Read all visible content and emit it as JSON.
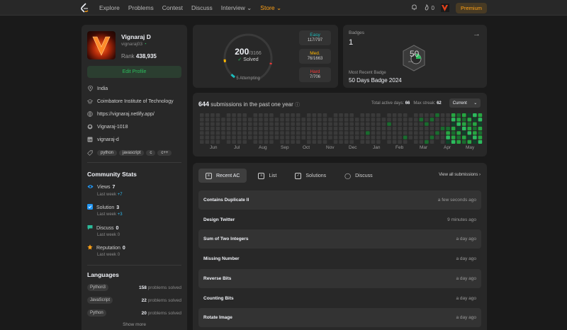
{
  "nav": {
    "items": [
      "Explore",
      "Problems",
      "Contest",
      "Discuss",
      "Interview ⌄",
      "Store ⌄"
    ],
    "streak_count": "0",
    "premium_label": "Premium"
  },
  "profile": {
    "name": "Vignaraj D",
    "username": "vignaraj03",
    "rank_label": "Rank",
    "rank_value": "438,935",
    "edit_label": "Edit Profile",
    "location": "India",
    "school": "Coimbatore Institute of Technology",
    "website": "https://vignaraj.netlify.app/",
    "github": "Vignaraj-1018",
    "linkedin": "vignaraj-d",
    "skills": [
      "python",
      "javascript",
      "c",
      "c++"
    ]
  },
  "community": {
    "title": "Community Stats",
    "stats": [
      {
        "label": "Views",
        "value": "7",
        "sub": "Last week",
        "delta": "+7"
      },
      {
        "label": "Solution",
        "value": "3",
        "sub": "Last week",
        "delta": "+3"
      },
      {
        "label": "Discuss",
        "value": "0",
        "sub": "Last week",
        "delta": "0"
      },
      {
        "label": "Reputation",
        "value": "0",
        "sub": "Last week",
        "delta": "0"
      }
    ]
  },
  "languages": {
    "title": "Languages",
    "items": [
      {
        "name": "Python3",
        "count": "158",
        "suffix": "problems solved"
      },
      {
        "name": "JavaScript",
        "count": "22",
        "suffix": "problems solved"
      },
      {
        "name": "Python",
        "count": "20",
        "suffix": "problems solved"
      }
    ],
    "show_more": "Show more"
  },
  "solved": {
    "count": "200",
    "total": "/3166",
    "label": "Solved",
    "attempting": "5 Attempting",
    "easy": {
      "label": "Easy",
      "value": "117/797",
      "color": "#1cbaba"
    },
    "medium": {
      "label": "Med.",
      "value": "76/1663",
      "color": "#ffb700"
    },
    "hard": {
      "label": "Hard",
      "value": "7/706",
      "color": "#f63737"
    }
  },
  "badges": {
    "title": "Badges",
    "count": "1",
    "recent_label": "Most Recent Badge",
    "recent_name": "50 Days Badge 2024",
    "badge_text": "50",
    "badge_year": "2024"
  },
  "submissions": {
    "count": "644",
    "text": "submissions in the past one year",
    "active_label": "Total active days:",
    "active_value": "66",
    "streak_label": "Max streak:",
    "streak_value": "62",
    "period": "Current",
    "months": [
      "Jun",
      "Jul",
      "Aug",
      "Sep",
      "Oct",
      "Nov",
      "Dec",
      "Jan",
      "Feb",
      "Mar",
      "Apr",
      "May"
    ]
  },
  "recent": {
    "tabs": [
      "Recent AC",
      "List",
      "Solutions",
      "Discuss"
    ],
    "view_all": "View all submissions",
    "rows": [
      {
        "title": "Contains Duplicate II",
        "when": "a few seconds ago"
      },
      {
        "title": "Design Twitter",
        "when": "9 minutes ago"
      },
      {
        "title": "Sum of Two Integers",
        "when": "a day ago"
      },
      {
        "title": "Missing Number",
        "when": "a day ago"
      },
      {
        "title": "Reverse Bits",
        "when": "a day ago"
      },
      {
        "title": "Counting Bits",
        "when": "a day ago"
      },
      {
        "title": "Rotate Image",
        "when": "a day ago"
      }
    ]
  },
  "colors": {
    "accent": "#ffa116",
    "green": "#2cbb5d",
    "card": "#282828",
    "background": "#1a1a1a"
  }
}
